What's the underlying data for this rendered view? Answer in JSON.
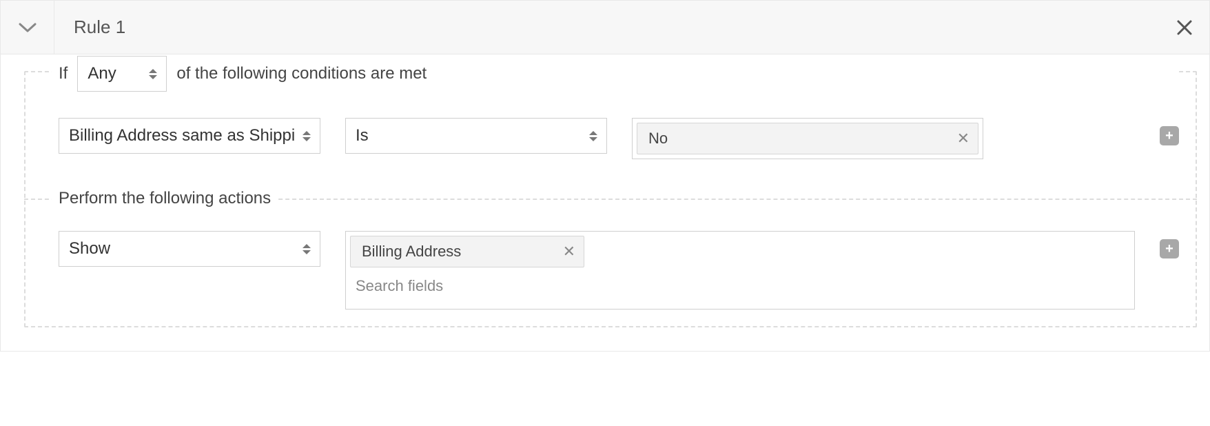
{
  "header": {
    "title": "Rule 1"
  },
  "condition_legend": {
    "if": "If",
    "mode": "Any",
    "suffix": "of the following conditions are met"
  },
  "condition_row": {
    "field": "Billing Address same as Shippir",
    "operator": "Is",
    "value": "No"
  },
  "actions_legend": "Perform the following actions",
  "action_row": {
    "action": "Show",
    "target": "Billing Address",
    "search_placeholder": "Search fields"
  }
}
